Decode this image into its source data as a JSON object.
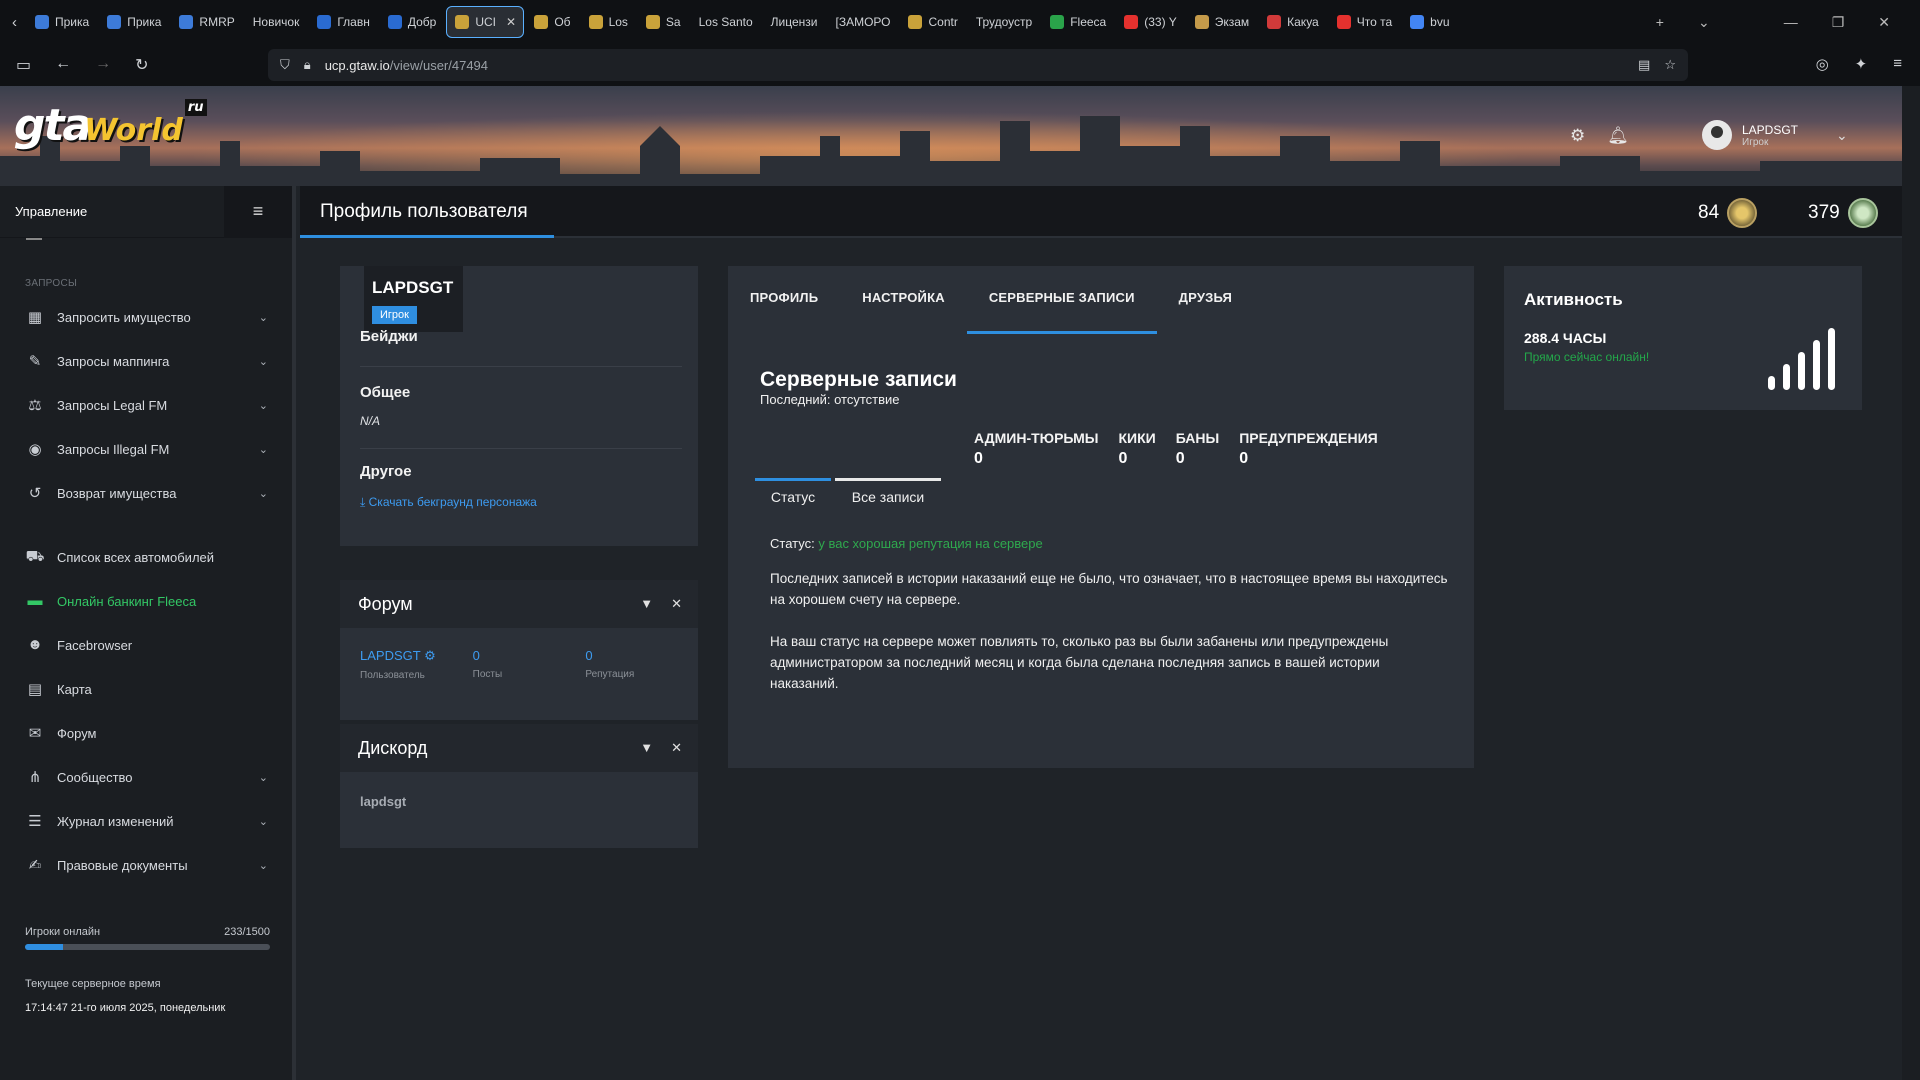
{
  "browser": {
    "tabs": [
      {
        "label": "Прика",
        "color": "#3d7bd8"
      },
      {
        "label": "Прика",
        "color": "#3d7bd8"
      },
      {
        "label": "RMRP",
        "color": "#3d7bd8"
      },
      {
        "label": "Новичок",
        "color": ""
      },
      {
        "label": "Главн",
        "color": "#2a6bd1"
      },
      {
        "label": "Добр",
        "color": "#2a6bd1"
      },
      {
        "label": "UCI",
        "color": "#c9a23a"
      },
      {
        "label": "Об",
        "color": "#c9a23a"
      },
      {
        "label": "Los",
        "color": "#c9a23a"
      },
      {
        "label": "Sa",
        "color": "#c9a23a"
      },
      {
        "label": "Los Santo",
        "color": ""
      },
      {
        "label": "Лицензи",
        "color": ""
      },
      {
        "label": "[ЗАМОРО",
        "color": ""
      },
      {
        "label": "Contr",
        "color": "#c9a23a"
      },
      {
        "label": "Трудоустр",
        "color": ""
      },
      {
        "label": "Fleeca",
        "color": "#2aa34a"
      },
      {
        "label": "(33) Y",
        "color": "#e5312e"
      },
      {
        "label": "Экзам",
        "color": "#c49a4a"
      },
      {
        "label": "Какуа",
        "color": "#d13a3a"
      },
      {
        "label": "Что та",
        "color": "#e5312e"
      },
      {
        "label": "bvu",
        "color": "#4285f4"
      }
    ],
    "active_tab_index": 6,
    "url_host": "ucp.gtaw.io",
    "url_path": "/view/user/47494"
  },
  "site": {
    "logo": {
      "gta": "gta",
      "world": "World",
      "ru": "ru"
    },
    "user": {
      "name": "LAPDSGT",
      "role": "Игрок"
    }
  },
  "sidebar": {
    "title": "Управление",
    "section": "ЗАПРОСЫ",
    "items": [
      {
        "label": "Запросить имущество",
        "icon": "building-icon",
        "glyph": "▦",
        "arrow": true
      },
      {
        "label": "Запросы маппинга",
        "icon": "brush-icon",
        "glyph": "✎",
        "arrow": true
      },
      {
        "label": "Запросы Legal FM",
        "icon": "scales-icon",
        "glyph": "⚖",
        "arrow": true
      },
      {
        "label": "Запросы Illegal FM",
        "icon": "mask-icon",
        "glyph": "◉",
        "arrow": true
      },
      {
        "label": "Возврат имущества",
        "icon": "undo-icon",
        "glyph": "↺",
        "arrow": true
      }
    ],
    "items2": [
      {
        "label": "Список всех автомобилей",
        "icon": "car-icon",
        "glyph": "⛟",
        "arrow": false
      },
      {
        "label": "Онлайн банкинг Fleeca",
        "icon": "money-icon",
        "glyph": "▬",
        "arrow": false,
        "green": true
      },
      {
        "label": "Facebrowser",
        "icon": "users-icon",
        "glyph": "☻",
        "arrow": false
      },
      {
        "label": "Карта",
        "icon": "map-icon",
        "glyph": "▤",
        "arrow": false
      },
      {
        "label": "Форум",
        "icon": "comments-icon",
        "glyph": "✉",
        "arrow": false
      },
      {
        "label": "Сообщество",
        "icon": "share-icon",
        "glyph": "⋔",
        "arrow": true
      },
      {
        "label": "Журнал изменений",
        "icon": "list-icon",
        "glyph": "☰",
        "arrow": true
      },
      {
        "label": "Правовые документы",
        "icon": "document-icon",
        "glyph": "✍",
        "arrow": true
      }
    ],
    "online": {
      "label": "Игроки онлайн",
      "value": "233/1500",
      "fraction": 0.155
    },
    "server_time": {
      "label": "Текущее серверное время",
      "value": "17:14:47 21-го июля 2025, понедельник"
    }
  },
  "header": {
    "title": "Профиль пользователя",
    "stat1": "84",
    "stat2": "379"
  },
  "profile": {
    "name": "LAPDSGT",
    "role": "Игрок",
    "badges_label": "Бейджи",
    "general_label": "Общее",
    "general_value": "N/A",
    "other_label": "Другое",
    "download_link": "Скачать бекграунд персонажа"
  },
  "forum_widget": {
    "title": "Форум",
    "user": "LAPDSGT",
    "user_label": "Пользователь",
    "posts": "0",
    "posts_label": "Посты",
    "rep": "0",
    "rep_label": "Репутация"
  },
  "discord_widget": {
    "title": "Дискорд",
    "name": "lapdsgt"
  },
  "main": {
    "tabs": [
      "ПРОФИЛЬ",
      "НАСТРОЙКА",
      "СЕРВЕРНЫЕ ЗАПИСИ",
      "ДРУЗЬЯ"
    ],
    "active_tab": 2,
    "title": "Серверные записи",
    "last": "Последний: отсутствие",
    "counts": [
      {
        "label": "АДМИН-ТЮРЬМЫ",
        "value": "0"
      },
      {
        "label": "КИКИ",
        "value": "0"
      },
      {
        "label": "БАНЫ",
        "value": "0"
      },
      {
        "label": "ПРЕДУПРЕЖДЕНИЯ",
        "value": "0"
      }
    ],
    "subtabs": [
      "Статус",
      "Все записи"
    ],
    "status_label": "Статус:",
    "status_value": "у вас хорошая репутация на сервере",
    "para1": "Последних записей в истории наказаний еще не было, что означает, что в настоящее время вы находитесь на хорошем счету на сервере.",
    "para2": "На ваш статус на сервере может повлиять то, сколько раз вы были забанены или предупреждены администратором за последний месяц и когда была сделана последняя запись в вашей истории наказаний."
  },
  "activity": {
    "title": "Активность",
    "hours": "288.4 ЧАСЫ",
    "online_now": "Прямо сейчас онлайн!"
  }
}
